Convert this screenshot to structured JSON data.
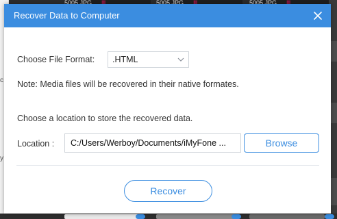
{
  "background": {
    "thumbnail_labels": [
      "5005.JPG",
      "5005.JPG",
      "5005.JPG"
    ],
    "left_fragments": [
      "c",
      "y"
    ],
    "accent_mark_color": "#d4145a"
  },
  "dialog": {
    "title": "Recover Data to Computer",
    "titlebar_color": "#3b8de0",
    "close_icon": "close-icon",
    "file_format": {
      "label": "Choose File Format:",
      "selected": ".HTML"
    },
    "note": "Note: Media files will be recovered in their native formates.",
    "location_prompt": "Choose a location to store the recovered data.",
    "location": {
      "label": "Location :",
      "path": "C:/Users/Werboy/Documents/iMyFone ...",
      "browse_label": "Browse"
    },
    "recover_label": "Recover"
  }
}
